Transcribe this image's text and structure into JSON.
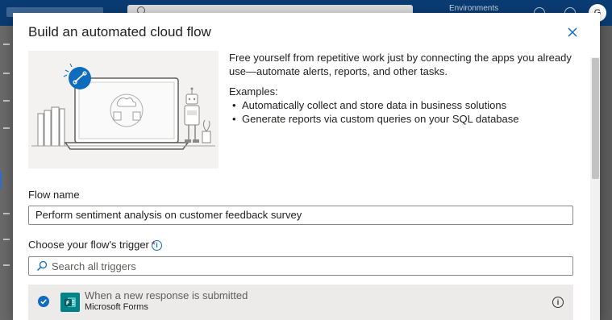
{
  "background": {
    "environment_label": "Environments",
    "avatar_initial": "G"
  },
  "dialog": {
    "title": "Build an automated cloud flow",
    "intro": "Free yourself from repetitive work just by connecting the apps you already use—automate alerts, reports, and other tasks.",
    "examples_label": "Examples:",
    "examples": [
      "Automatically collect and store data in business solutions",
      "Generate reports via custom queries on your SQL database"
    ],
    "flow_name_label": "Flow name",
    "flow_name_value": "Perform sentiment analysis on customer feedback survey",
    "trigger_label": "Choose your flow's trigger",
    "required_marker": "*",
    "trigger_search_placeholder": "Search all triggers",
    "triggers": [
      {
        "title": "When a new response is submitted",
        "connector": "Microsoft Forms",
        "selected": true
      }
    ]
  },
  "colors": {
    "accent": "#0f6cbd",
    "forms_brand": "#038387",
    "required": "#a4262c"
  }
}
